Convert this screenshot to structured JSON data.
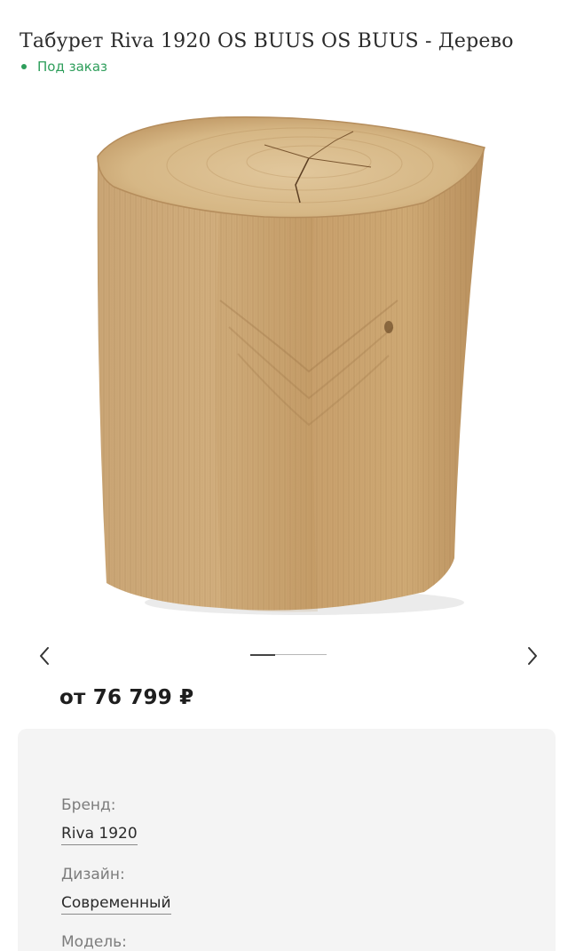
{
  "product": {
    "title": "Табурет Riva 1920 OS BUUS OS BUUS - Дерево",
    "availability": "Под заказ",
    "price": "от 76 799 ₽",
    "image": {
      "subject": "wooden-log-stool",
      "colors": {
        "wood_light": "#d9bb8c",
        "wood_mid": "#c9a26f",
        "wood_dark": "#a57e4f"
      }
    }
  },
  "carousel": {
    "prev_icon": "chevron-left-icon",
    "next_icon": "chevron-right-icon",
    "total_slides": 3,
    "current_slide": 1
  },
  "specs": {
    "brand_label": "Бренд:",
    "brand_value": "Riva 1920",
    "design_label": "Дизайн:",
    "design_value": "Современный",
    "model_label": "Модель:"
  },
  "colors": {
    "accent_green": "#2e9e5b",
    "panel_bg": "#f4f4f4",
    "label_gray": "#7c7c7c"
  }
}
